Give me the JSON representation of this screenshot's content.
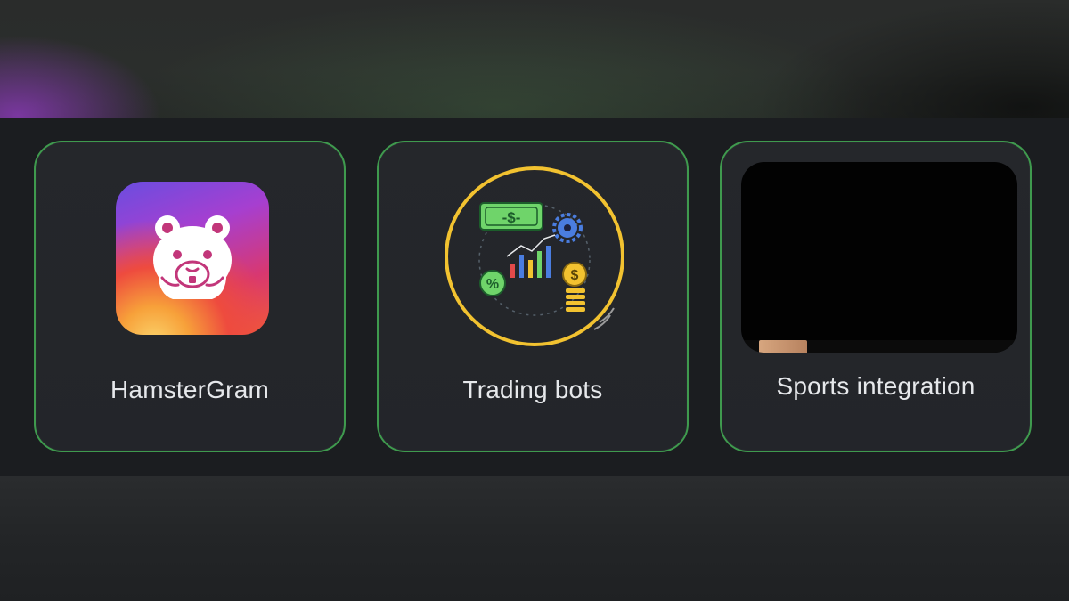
{
  "cards": [
    {
      "label": "HamsterGram",
      "icon": "hamster-app-icon"
    },
    {
      "label": "Trading bots",
      "icon": "trading-bots-icon"
    },
    {
      "label": "Sports integration",
      "icon": "video-preview"
    }
  ],
  "colors": {
    "card_border": "#3f9a4e",
    "card_bg": "#24262a",
    "strip_bg": "#1b1d20",
    "label_text": "#e6e8eb",
    "ring_yellow": "#f2c230",
    "money_green": "#6fd46a"
  }
}
